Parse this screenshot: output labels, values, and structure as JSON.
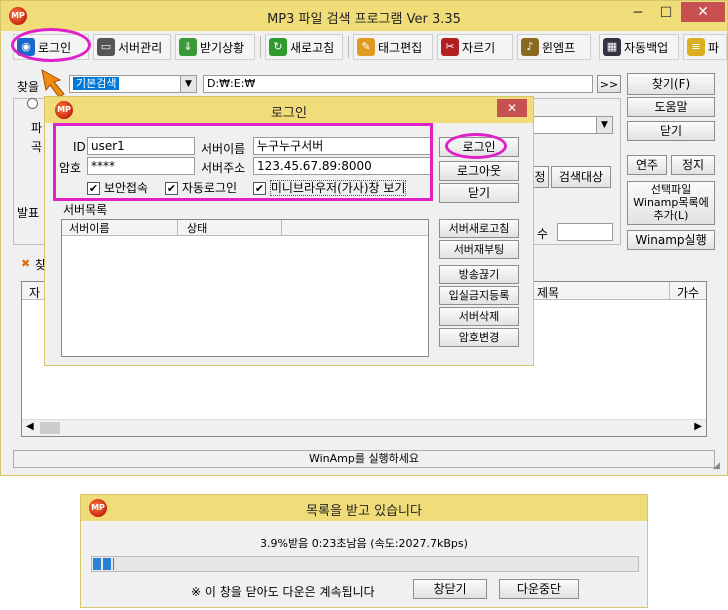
{
  "main": {
    "title": "MP3 파일 검색 프로그램 Ver 3.35",
    "toolbar": [
      {
        "label": "로그인",
        "icon": "globe-icon"
      },
      {
        "label": "서버관리",
        "icon": "server-icon"
      },
      {
        "label": "받기상황",
        "icon": "download-icon"
      },
      {
        "label": "새로고침",
        "icon": "refresh-icon"
      },
      {
        "label": "태그편집",
        "icon": "tag-icon"
      },
      {
        "label": "자르기",
        "icon": "cut-icon"
      },
      {
        "label": "윈엠프",
        "icon": "winamp-icon"
      },
      {
        "label": "자동백업",
        "icon": "backup-icon"
      },
      {
        "label": "파",
        "icon": "file-icon"
      }
    ],
    "search_label": "찾을",
    "search_mode": "기본검색",
    "path_value": "D:₩:E:₩",
    "path_nav": ">>",
    "right_buttons": [
      "찾기(F)",
      "도움말",
      "닫기"
    ],
    "play_buttons": [
      "연주",
      "정지"
    ],
    "winamp_add": "선택파일 Winamp목록에 추가(L)",
    "winamp_run_button": "Winamp실행",
    "search_target_button": "검색대상",
    "partial_labels": [
      "파",
      "곡",
      "발표"
    ],
    "hidden_labels": [
      "정",
      "수"
    ],
    "results_label": "찾",
    "columns": [
      "자",
      "제목",
      "가수"
    ],
    "status": "WinAmp를 실행하세요"
  },
  "login": {
    "title": "로그인",
    "id_label": "ID",
    "id_value": "user1",
    "pw_label": "암호",
    "pw_value": "****",
    "server_name_label": "서버이름",
    "server_name_value": "누구누구서버",
    "server_addr_label": "서버주소",
    "server_addr_value": "123.45.67.89:8000",
    "checkboxes": [
      {
        "label": "보안접속",
        "checked": true
      },
      {
        "label": "자동로그인",
        "checked": true
      },
      {
        "label": "미니브라우저(가사)창 보기",
        "checked": true
      }
    ],
    "login_button": "로그인",
    "logout_button": "로그아웃",
    "close_button": "닫기",
    "server_list_label": "서버목록",
    "server_list_columns": [
      "서버이름",
      "상태"
    ],
    "server_buttons": [
      "서버새로고침",
      "서버재부팅",
      "방송끊기",
      "입실금지등록",
      "서버삭제",
      "암호변경"
    ]
  },
  "download": {
    "title": "목록을 받고 있습니다",
    "status_text": "3.9%받음 0:23초남음 (속도:2027.7kBps)",
    "progress": 0.039,
    "notice": "※ 이 창을 닫아도 다운은 계속됩니다",
    "close_button": "창닫기",
    "stop_button": "다운중단"
  },
  "colors": {
    "title_bar": "#f0dc78",
    "highlight": "#e020c8",
    "selected": "#0078d7",
    "close": "#c75050"
  }
}
